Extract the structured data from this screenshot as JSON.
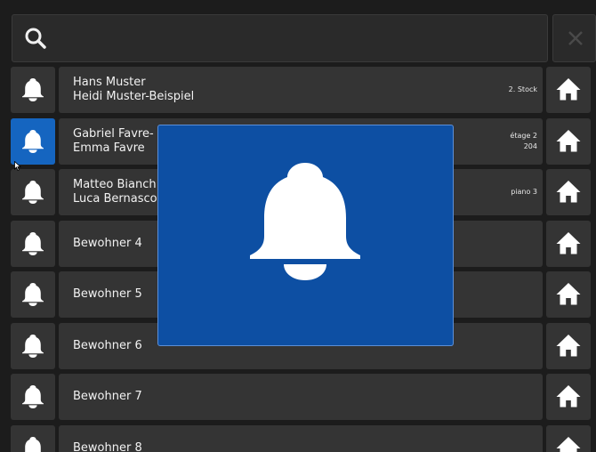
{
  "search": {
    "value": "",
    "placeholder": "",
    "icon": "search-icon",
    "clear_icon": "close-icon"
  },
  "residents": [
    {
      "line1": "Hans Muster",
      "line2": "Heidi Muster-Beispiel",
      "floor1": "2. Stock",
      "floor2": "",
      "active": false
    },
    {
      "line1": "Gabriel Favre-",
      "line2": "Emma Favre",
      "floor1": "étage 2",
      "floor2": "204",
      "active": true
    },
    {
      "line1": "Matteo Bianch",
      "line2": "Luca Bernasco",
      "floor1": "piano 3",
      "floor2": "",
      "active": false
    },
    {
      "line1": "Bewohner 4",
      "line2": "",
      "floor1": "",
      "floor2": "",
      "active": false
    },
    {
      "line1": "Bewohner 5",
      "line2": "",
      "floor1": "",
      "floor2": "",
      "active": false
    },
    {
      "line1": "Bewohner 6",
      "line2": "",
      "floor1": "",
      "floor2": "",
      "active": false
    },
    {
      "line1": "Bewohner 7",
      "line2": "",
      "floor1": "",
      "floor2": "",
      "active": false
    },
    {
      "line1": "Bewohner 8",
      "line2": "",
      "floor1": "",
      "floor2": "",
      "active": false
    }
  ],
  "icons": {
    "row_left": "bell-icon",
    "row_right": "home-icon",
    "modal": "bell-icon"
  },
  "colors": {
    "background": "#1c1c1c",
    "cell": "#343434",
    "accent": "#1565c0",
    "modal": "#0d4fa3"
  }
}
